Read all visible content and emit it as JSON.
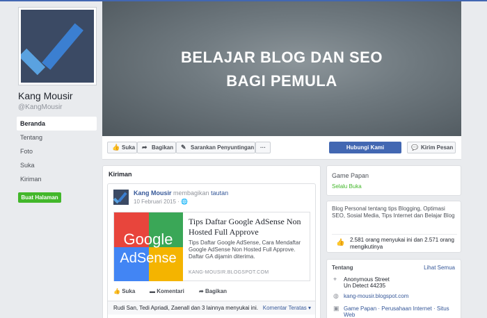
{
  "page": {
    "name": "Kang Mousir",
    "handle": "@KangMousir",
    "cover_title_line1": "BELAJAR BLOG DAN SEO",
    "cover_title_line2": "BAGI PEMULA"
  },
  "nav": {
    "items": [
      {
        "label": "Beranda",
        "active": true
      },
      {
        "label": "Tentang"
      },
      {
        "label": "Foto"
      },
      {
        "label": "Suka"
      },
      {
        "label": "Kiriman"
      }
    ],
    "create_page": "Buat Halaman"
  },
  "actions": {
    "like": "Suka",
    "share": "Bagikan",
    "suggest": "Sarankan Penyuntingan",
    "more": "···",
    "contact": "Hubungi Kami",
    "message": "Kirim Pesan"
  },
  "posts": {
    "title": "Kiriman",
    "post": {
      "author": "Kang Mousir",
      "action": "membagikan",
      "link_word": "tautan",
      "date": "10 Februari 2015 ·",
      "card": {
        "title": "Tips Daftar Google AdSense Non Hosted Full Approve",
        "description": "Tips Daftar Google AdSense, Cara Mendaftar Google AdSense Non Hosted Full Approve. Daftar GA dijamin diterima.",
        "url": "KANG-MOUSIR.BLOGSPOT.COM",
        "image_text_1": "Google",
        "image_text_2": "AdSense"
      },
      "like": "Suka",
      "comment": "Komentari",
      "share": "Bagikan",
      "likers": "Rudi San, Tedi Apriadi, Zaenall dan 3 lainnya menyukai ini.",
      "top_comments": "Komentar Teratas ▾"
    }
  },
  "sidebar": {
    "category": "Game Papan",
    "status": "Selalu Buka",
    "about": "Blog Personal tentang tips Blogging, Optimasi SEO, Sosial Media, Tips Internet dan Belajar Blog",
    "likes": "2.581 orang menyukai ini dan 2.571 orang mengikutinya",
    "about_title": "Tentang",
    "see_all": "Lihat Semua",
    "address_line1": "Anonymous Street",
    "address_line2": "Un Detect 44235",
    "website": "kang-mousir.blogspot.com",
    "categories": "Game Papan · Perusahaan Internet · Situs Web"
  },
  "colors": {
    "brand_blue": "#4267b2",
    "link_blue": "#365899",
    "green": "#42b72a",
    "background": "#e9ebee"
  }
}
